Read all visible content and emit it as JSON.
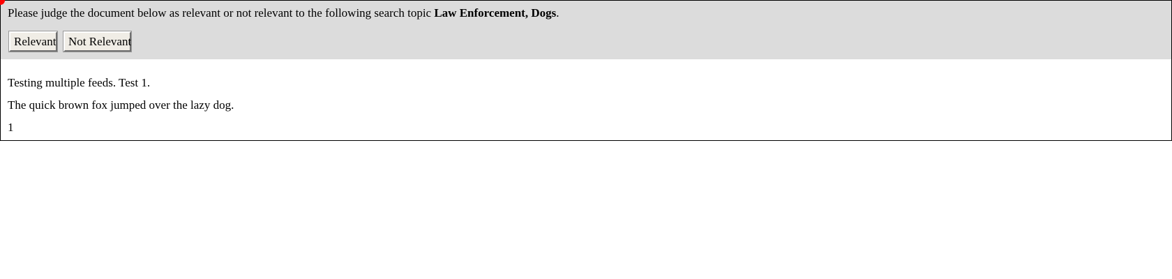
{
  "judge": {
    "prompt_prefix": "Please judge the document below as relevant or not relevant to the following search topic ",
    "topic": "Law Enforcement, Dogs",
    "prompt_suffix": ".",
    "relevant_label": "Relevant",
    "not_relevant_label": "Not Relevant"
  },
  "document": {
    "lines": [
      "Testing multiple feeds. Test 1.",
      "The quick brown fox jumped over the lazy dog.",
      "1"
    ]
  },
  "colors": {
    "panel_background": "#dcdcdc",
    "cursor_marker": "#ff0000"
  }
}
